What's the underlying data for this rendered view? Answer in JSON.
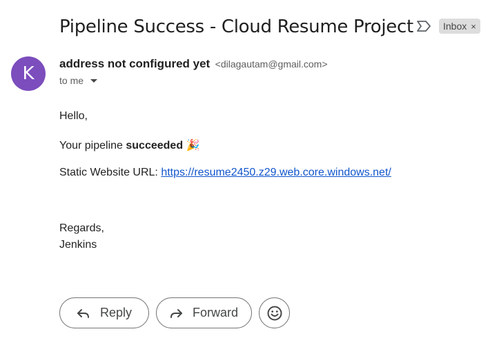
{
  "email": {
    "subject": "Pipeline Success - Cloud Resume Project",
    "label": "Inbox",
    "label_close": "×",
    "sender_initial": "K",
    "sender_name": "address not configured yet",
    "sender_email": "<dilagautam@gmail.com>",
    "recipient_text": "to me",
    "greeting": "Hello,",
    "pipeline_prefix": "Your pipeline ",
    "pipeline_status": "succeeded",
    "pipeline_emoji": "🎉",
    "url_prefix": "Static Website URL: ",
    "url": "https://resume2450.z29.web.core.windows.net/",
    "regards": "Regards,",
    "signature": "Jenkins"
  },
  "actions": {
    "reply_label": "Reply",
    "forward_label": "Forward"
  },
  "icons": {
    "important": "important-marker-icon",
    "reply": "reply-arrow-icon",
    "forward": "forward-arrow-icon",
    "emoji": "smiley-face-icon",
    "to_dropdown": "caret-down-icon"
  },
  "colors": {
    "avatar": "#7c4dbd",
    "link": "#1155cc",
    "label_chip": "#dddddd"
  }
}
